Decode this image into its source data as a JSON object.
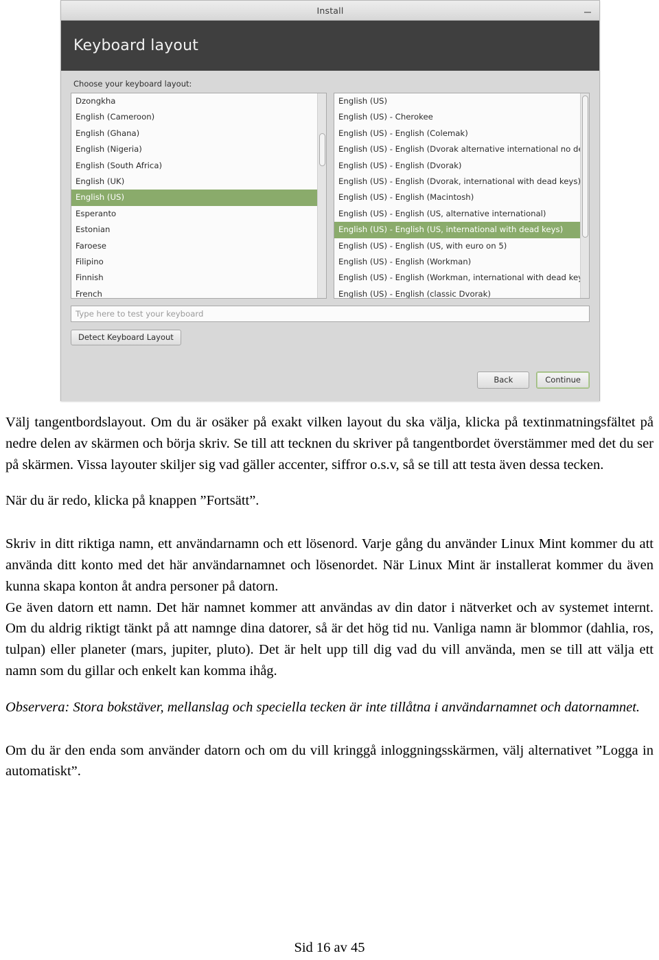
{
  "installer": {
    "titlebar": {
      "title": "Install",
      "minimize_label": "−"
    },
    "header_title": "Keyboard layout",
    "choose_label": "Choose your keyboard layout:",
    "layout_list": {
      "items": [
        "Dzongkha",
        "English (Cameroon)",
        "English (Ghana)",
        "English (Nigeria)",
        "English (South Africa)",
        "English (UK)",
        "English (US)",
        "Esperanto",
        "Estonian",
        "Faroese",
        "Filipino",
        "Finnish",
        "French"
      ],
      "selected": "English (US)",
      "selected_index": 6
    },
    "variant_list": {
      "items": [
        "English (US)",
        "English (US) - Cherokee",
        "English (US) - English (Colemak)",
        "English (US) - English (Dvorak alternative international no dead k",
        "English (US) - English (Dvorak)",
        "English (US) - English (Dvorak, international with dead keys)",
        "English (US) - English (Macintosh)",
        "English (US) - English (US, alternative international)",
        "English (US) - English (US, international with dead keys)",
        "English (US) - English (US, with euro on 5)",
        "English (US) - English (Workman)",
        "English (US) - English (Workman, international with dead keys)",
        "English (US) - English (classic Dvorak)"
      ],
      "selected": "English (US) - English (US, international with dead keys)",
      "selected_index": 8
    },
    "test_input": {
      "value": "",
      "placeholder": "Type here to test your keyboard"
    },
    "detect_button": "Detect Keyboard Layout",
    "back_button": "Back",
    "continue_button": "Continue",
    "colors": {
      "selection_green": "#8aab6b",
      "header_dark": "#3f3f3f",
      "window_grey": "#d8d8d8",
      "continue_focus_border": "#9cb97d"
    }
  },
  "document": {
    "paragraphs": [
      "Välj tangentbordslayout. Om du är osäker på exakt vilken layout du ska välja, klicka på textinmatningsfältet på nedre delen av skärmen och börja skriv. Se till att tecknen du skriver på tangentbordet överstämmer med det du ser på skärmen. Vissa layouter skiljer sig vad gäller accenter, siffror o.s.v, så se till att testa även dessa tecken.",
      "När du är redo, klicka på knappen ”Fortsätt”.",
      "Skriv in ditt riktiga namn, ett användarnamn och ett lösenord. Varje gång du använder Linux Mint kommer du att använda ditt konto med det här användarnamnet och lösenordet. När Linux Mint är installerat kommer du även kunna skapa konton åt andra personer på datorn.",
      "Ge även datorn ett namn. Det här namnet kommer att användas av din dator i nätverket och av systemet internt. Om du aldrig riktigt tänkt på att namnge dina datorer, så är det hög tid nu. Vanliga namn är blommor (dahlia, ros, tulpan) eller planeter (mars, jupiter, pluto). Det är helt upp till dig vad du vill använda, men se till att välja ett namn som du gillar och enkelt kan komma ihåg.",
      "Observera: Stora bokstäver, mellanslag och speciella tecken är inte tillåtna i användarnamnet och datornamnet.",
      "Om du är den enda som använder datorn och om du vill kringgå inloggningsskärmen, välj alternativet ”Logga in automatiskt”."
    ],
    "footer": "Sid 16 av 45"
  }
}
